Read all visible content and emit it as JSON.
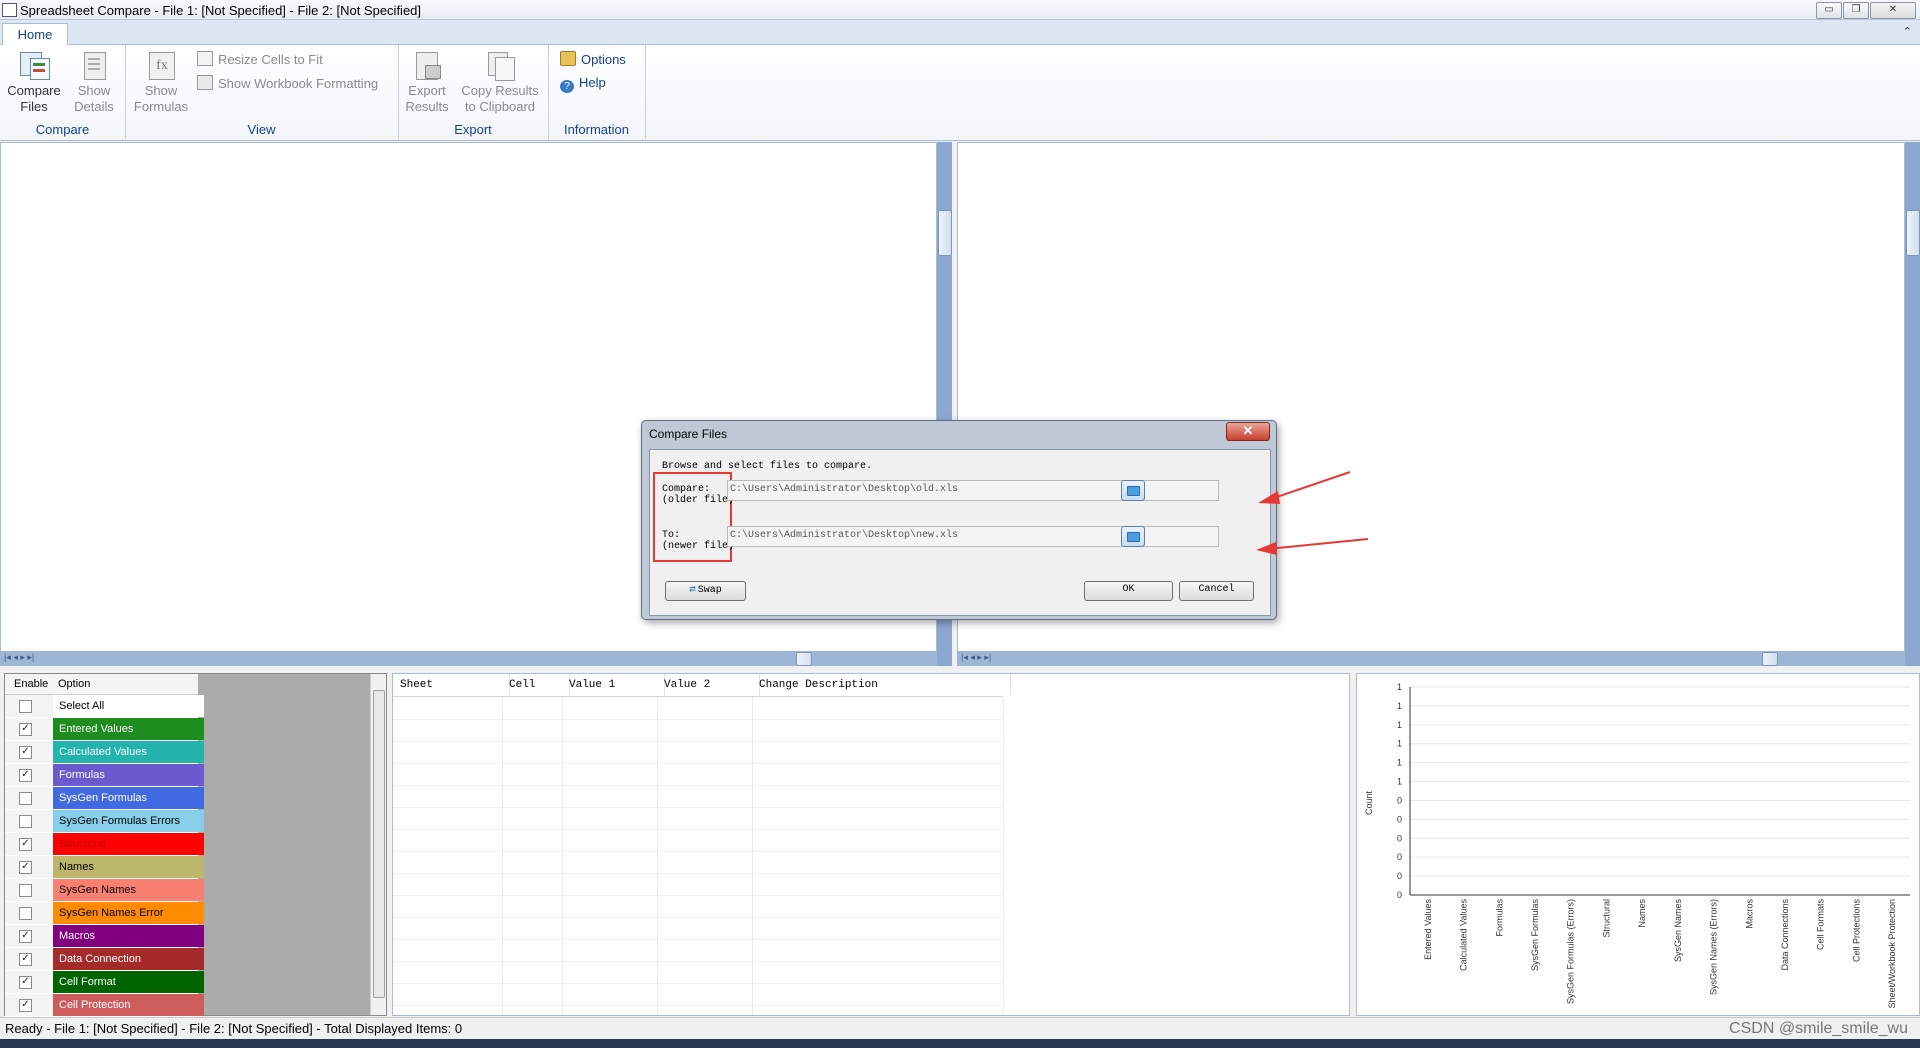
{
  "window": {
    "title": "Spreadsheet Compare - File 1: [Not Specified] - File 2: [Not Specified]",
    "controls": {
      "minimize": "▭",
      "restore": "❐",
      "close": "✕"
    }
  },
  "ribbon": {
    "tabs": [
      "Home"
    ],
    "collapse_glyph": "⌃",
    "groups": {
      "compare": {
        "label": "Compare",
        "compare_files": "Compare\nFiles",
        "show_details": "Show\nDetails"
      },
      "view": {
        "label": "View",
        "show_formulas": "Show\nFormulas",
        "resize_cells": "Resize Cells to Fit",
        "show_workbook_formatting": "Show Workbook Formatting"
      },
      "export": {
        "label": "Export",
        "export_results": "Export\nResults",
        "copy_results": "Copy Results\nto Clipboard"
      },
      "information": {
        "label": "Information",
        "options": "Options",
        "help": "Help"
      }
    }
  },
  "dialog": {
    "title": "Compare Files",
    "close_glyph": "✕",
    "instruction": "Browse and select files to compare.",
    "compare_label_1": "Compare:",
    "compare_label_2": "(older file)",
    "compare_path": "C:\\Users\\Administrator\\Desktop\\old.xls",
    "to_label_1": "To:",
    "to_label_2": "(newer file)",
    "to_path": "C:\\Users\\Administrator\\Desktop\\new.xls",
    "swap_label": "Swap",
    "ok_label": "OK",
    "cancel_label": "Cancel"
  },
  "options_panel": {
    "header_enable": "Enable",
    "header_option": "Option",
    "items": [
      {
        "label": "Select All",
        "checked": false,
        "color": "#ffffff",
        "text_color": "#000000"
      },
      {
        "label": "Entered Values",
        "checked": true,
        "color": "#1e8c1e",
        "text_color": "#ffffff"
      },
      {
        "label": "Calculated Values",
        "checked": true,
        "color": "#22b3ac",
        "text_color": "#ffffff"
      },
      {
        "label": "Formulas",
        "checked": true,
        "color": "#6a5acd",
        "text_color": "#ffffff"
      },
      {
        "label": "SysGen Formulas",
        "checked": false,
        "color": "#4169e1",
        "text_color": "#ffffff"
      },
      {
        "label": "SysGen Formulas Errors",
        "checked": false,
        "color": "#87ceeb",
        "text_color": "#000000"
      },
      {
        "label": "Structural",
        "checked": true,
        "color": "#ff0000",
        "text_color": "#c00000"
      },
      {
        "label": "Names",
        "checked": true,
        "color": "#bdb76b",
        "text_color": "#000000"
      },
      {
        "label": "SysGen Names",
        "checked": false,
        "color": "#fa8072",
        "text_color": "#000000"
      },
      {
        "label": "SysGen Names Error",
        "checked": false,
        "color": "#ff8c00",
        "text_color": "#000000"
      },
      {
        "label": "Macros",
        "checked": true,
        "color": "#800080",
        "text_color": "#ffffff"
      },
      {
        "label": "Data Connection",
        "checked": true,
        "color": "#a52a2a",
        "text_color": "#ffffff"
      },
      {
        "label": "Cell Format",
        "checked": true,
        "color": "#006400",
        "text_color": "#ffffff"
      },
      {
        "label": "Cell Protection",
        "checked": true,
        "color": "#cd5c5c",
        "text_color": "#ffffff"
      }
    ]
  },
  "results_table": {
    "columns": [
      "Sheet",
      "Cell",
      "Value 1",
      "Value 2",
      "Change Description"
    ]
  },
  "chart_data": {
    "type": "bar",
    "ylabel": "Count",
    "yticks": [
      "1",
      "1",
      "1",
      "1",
      "1",
      "1",
      "0",
      "0",
      "0",
      "0",
      "0",
      "0"
    ],
    "categories": [
      "Entered Values",
      "Calculated Values",
      "Formulas",
      "SysGen Formulas",
      "SysGen Formulas (Errors)",
      "Structural",
      "Names",
      "SysGen Names",
      "SysGen Names (Errors)",
      "Macros",
      "Data Connections",
      "Cell Formats",
      "Cell Protections",
      "Sheet/Workbook Protection"
    ],
    "values": [
      0,
      0,
      0,
      0,
      0,
      0,
      0,
      0,
      0,
      0,
      0,
      0,
      0,
      0
    ],
    "grid": true
  },
  "status": {
    "text": "Ready - File 1: [Not Specified] - File 2: [Not Specified] - Total Displayed Items: 0",
    "watermark": "CSDN @smile_smile_wu"
  },
  "colors": {
    "accent": "#15428b",
    "annotation_red": "#e53935"
  }
}
